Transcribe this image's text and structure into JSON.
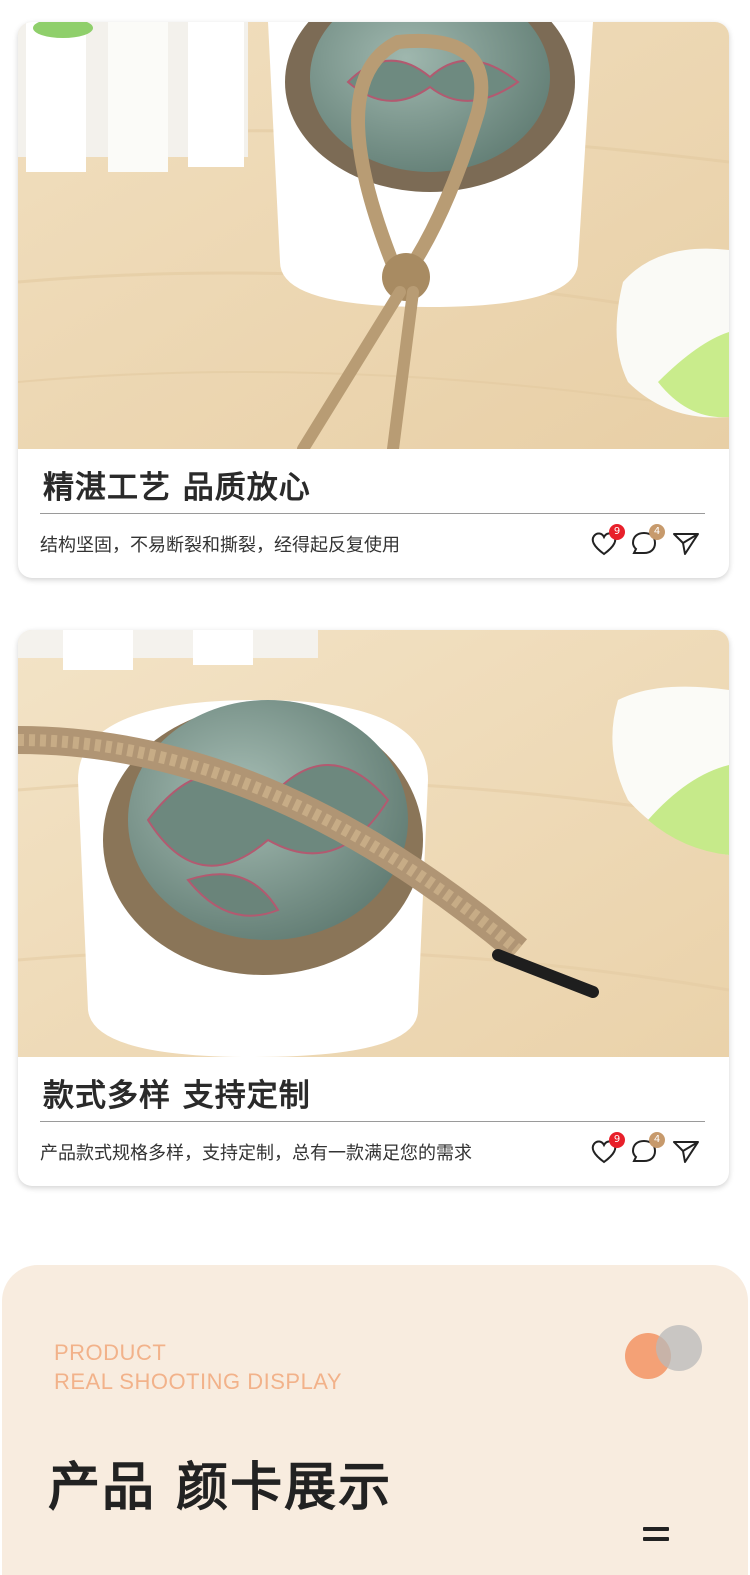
{
  "cards": [
    {
      "title": "精湛工艺 品质放心",
      "description": "结构坚固，不易断裂和撕裂，经得起反复使用",
      "like_count": "9",
      "comment_count": "4",
      "icons": [
        "heart-icon",
        "comment-icon",
        "share-icon"
      ]
    },
    {
      "title": "款式多样 支持定制",
      "description": "产品款式规格多样，支持定制，总有一款满足您的需求",
      "like_count": "9",
      "comment_count": "4",
      "icons": [
        "heart-icon",
        "comment-icon",
        "share-icon"
      ]
    }
  ],
  "section": {
    "english_line1": "PRODUCT",
    "english_line2": "REAL SHOOTING DISPLAY",
    "title": "产品 颜卡展示"
  },
  "colors": {
    "panel_bg": "#f8ecdf",
    "accent_orange": "#f4a176",
    "english_text": "#f2b28a",
    "like_badge": "#e8202a",
    "comment_badge": "#c79a6c"
  }
}
